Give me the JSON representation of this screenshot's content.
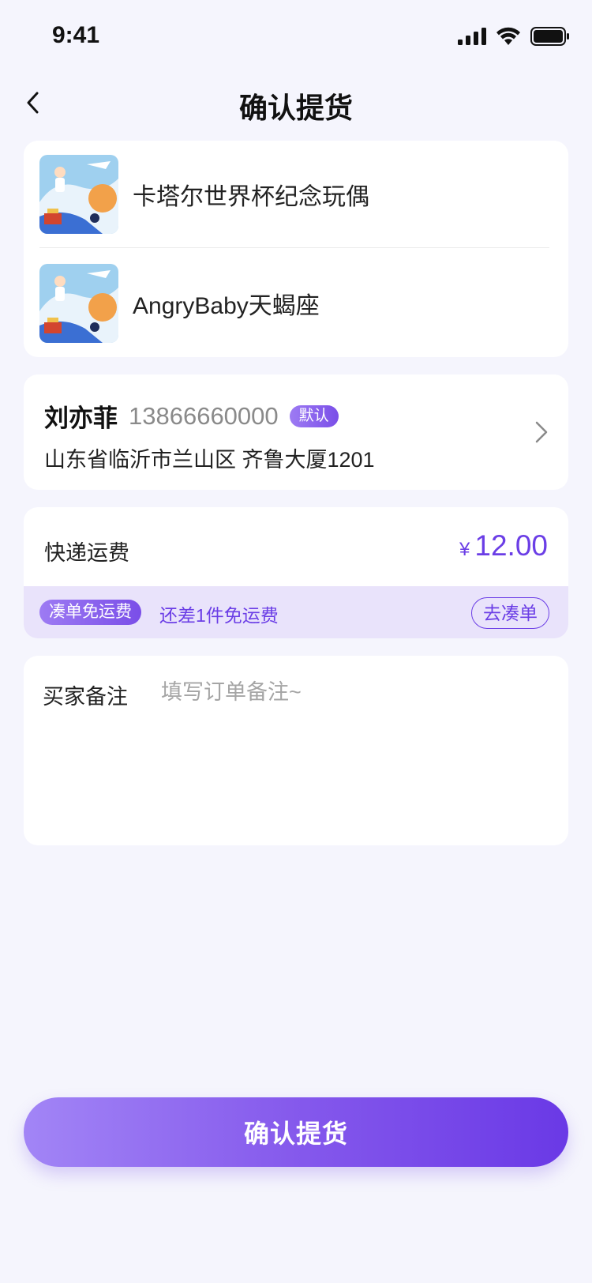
{
  "status_bar": {
    "time": "9:41"
  },
  "header": {
    "title": "确认提货"
  },
  "products": [
    {
      "name": "卡塔尔世界杯纪念玩偶"
    },
    {
      "name": "AngryBaby天蝎座"
    }
  ],
  "address": {
    "name": "刘亦菲",
    "phone": "13866660000",
    "badge": "默认",
    "detail": "山东省临沂市兰山区  齐鲁大厦1201"
  },
  "shipping": {
    "label": "快递运费",
    "currency": "¥",
    "amount": "12.00",
    "free_badge": "凑单免运费",
    "free_text": "还差1件免运费",
    "free_button": "去凑单"
  },
  "remark": {
    "label": "买家备注",
    "placeholder": "填写订单备注~",
    "value": ""
  },
  "confirm_button": "确认提货",
  "colors": {
    "accent": "#6b3ee6",
    "background": "#f5f5fd"
  }
}
